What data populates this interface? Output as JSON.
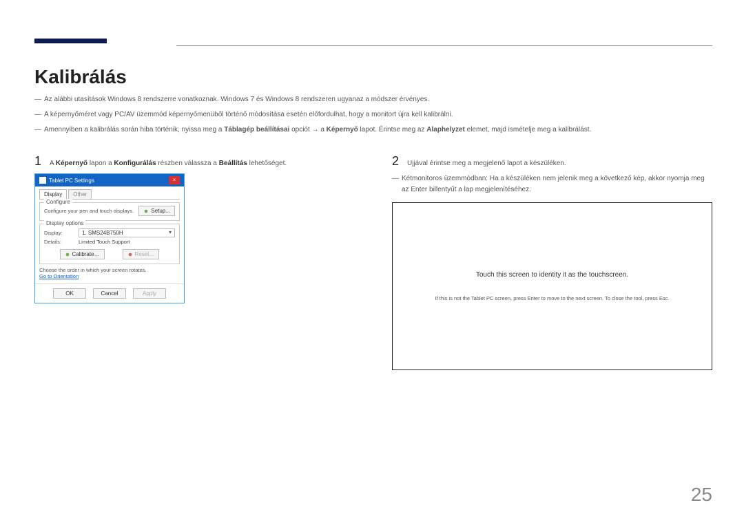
{
  "heading": "Kalibrálás",
  "intro": [
    "Az alábbi utasítások Windows 8 rendszerre vonatkoznak. Windows 7 és Windows 8 rendszeren ugyanaz a módszer érvényes.",
    "A képernyőméret vagy PC/AV üzemmód képernyőmenüből történő módosítása esetén előfordulhat, hogy a monitort újra kell kalibrálni."
  ],
  "intro3": {
    "pre": "Amennyiben a kalibrálás során hiba történik, nyissa meg a ",
    "b1": "Táblagép beállításai",
    "mid1": " opciót → a ",
    "b2": "Képernyő",
    "mid2": " lapot. Érintse meg az ",
    "b3": "Alaphelyzet",
    "post": " elemet, majd ismételje meg a kalibrálást."
  },
  "step1": {
    "num": "1",
    "pre": "A ",
    "b1": "Képernyő",
    "mid1": " lapon a ",
    "b2": "Konfigurálás",
    "mid2": " részben válassza a ",
    "b3": "Beállítás",
    "post": " lehetőséget."
  },
  "step2": {
    "num": "2",
    "text": "Ujjával érintse meg a megjelenő lapot a készüléken."
  },
  "step2note": "Kétmonitoros üzemmódban: Ha a készüléken nem jelenik meg a következő kép, akkor nyomja meg az Enter billentyűt a lap megjelenítéséhez.",
  "dialog": {
    "title": "Tablet PC Settings",
    "close": "×",
    "tabs": {
      "active": "Display",
      "inactive": "Other"
    },
    "configure": {
      "label": "Configure",
      "text": "Configure your pen and touch displays.",
      "setup": "Setup..."
    },
    "disp_options": {
      "label": "Display options",
      "display_lbl": "Display:",
      "display_val": "1. SMS24B750H",
      "details_lbl": "Details:",
      "details_val": "Limited Touch Support",
      "calibrate": "Calibrate…",
      "reset": "Reset…"
    },
    "rotate_note": "Choose the order in which your screen rotates.",
    "link": "Go to Orientation",
    "ok": "OK",
    "cancel": "Cancel",
    "apply": "Apply"
  },
  "touch": {
    "line1": "Touch this screen to identity it as the touchscreen.",
    "line2": "If this is not the Tablet PC screen, press Enter to move to the next screen. To close the tool, press Esc."
  },
  "pagenum": "25"
}
